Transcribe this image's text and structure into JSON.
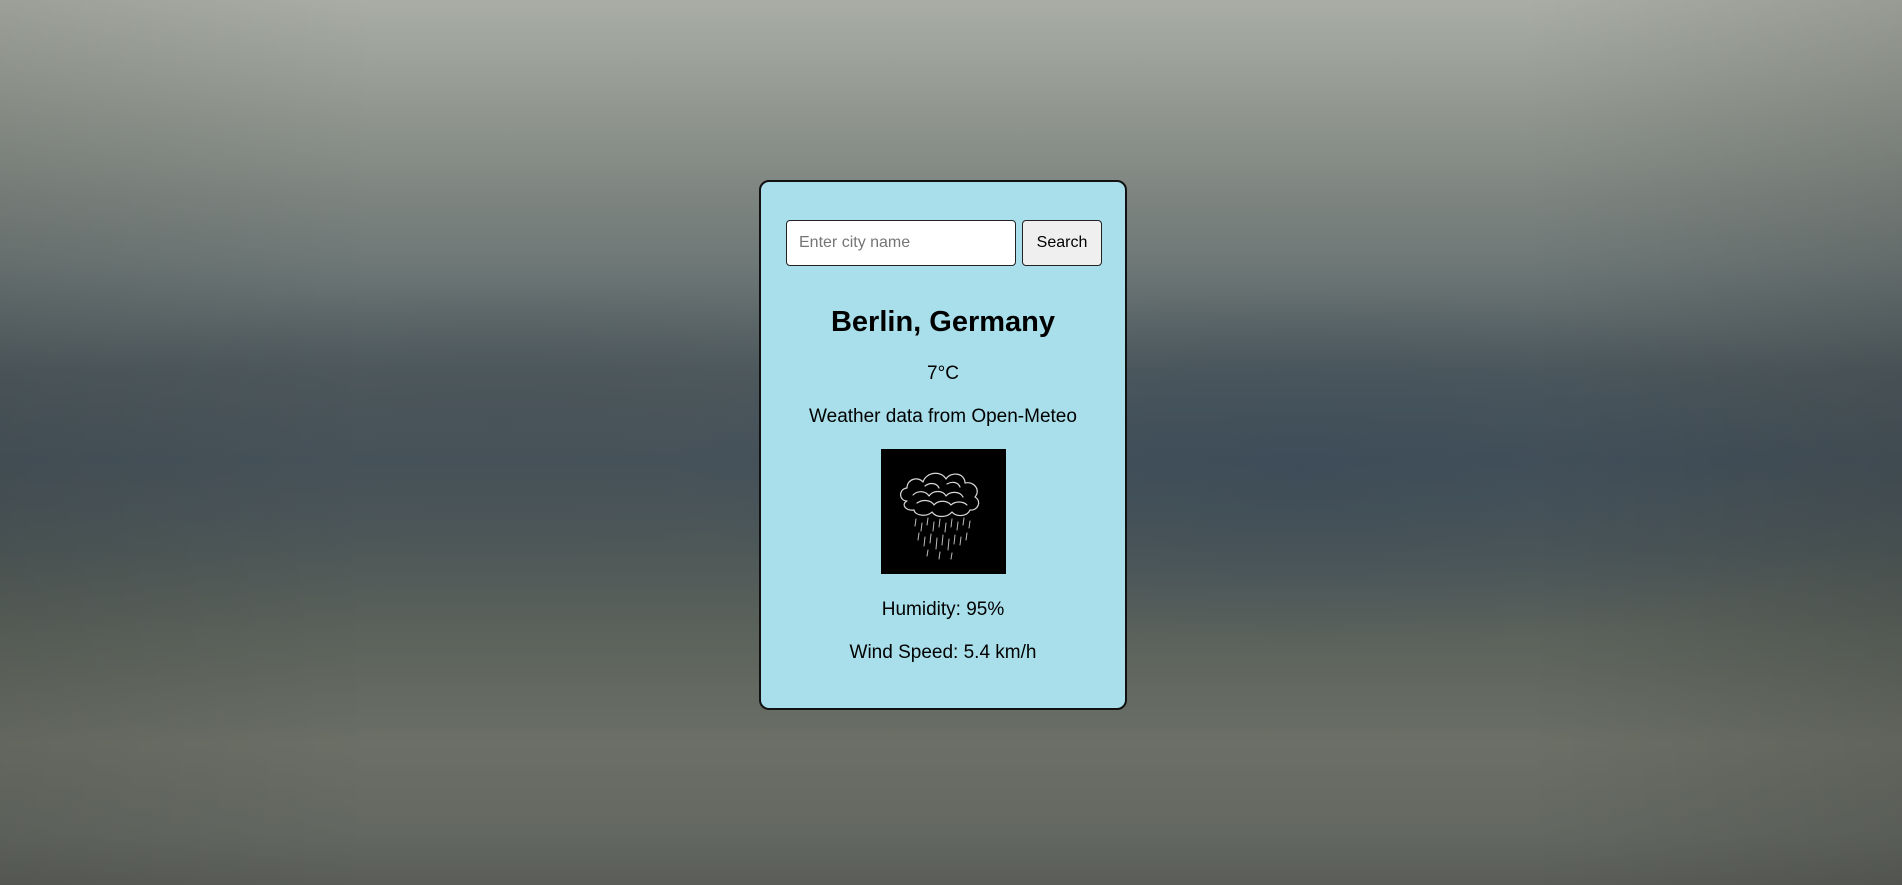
{
  "search": {
    "placeholder": "Enter city name",
    "value": "",
    "button_label": "Search"
  },
  "weather": {
    "location": "Berlin, Germany",
    "temperature": "7°C",
    "source_text": "Weather data from Open-Meteo",
    "icon": "rain-cloud-icon",
    "humidity_text": "Humidity: 95%",
    "wind_text": "Wind Speed: 5.4 km/h"
  },
  "colors": {
    "card_background": "#a8dfea",
    "card_border": "#111111",
    "icon_background": "#000000"
  }
}
